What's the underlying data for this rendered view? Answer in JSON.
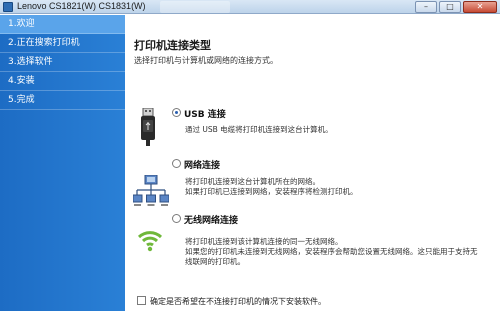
{
  "window": {
    "title": "Lenovo CS1821(W) CS1831(W)",
    "buttons": {
      "minimize": "–",
      "maximize": "□",
      "close": "✕"
    }
  },
  "sidebar": {
    "steps": [
      {
        "label": "1.欢迎"
      },
      {
        "label": "2.正在搜索打印机"
      },
      {
        "label": "3.选择软件"
      },
      {
        "label": "4.安装"
      },
      {
        "label": "5.完成"
      }
    ]
  },
  "main": {
    "heading": "打印机连接类型",
    "subheading": "选择打印机与计算机或网络的连接方式。",
    "options": [
      {
        "label": "USB 连接",
        "icon": "usb-plug-icon",
        "selected": true,
        "desc": [
          "通过 USB 电缆将打印机连接到这台计算机。"
        ]
      },
      {
        "label": "网络连接",
        "icon": "network-icon",
        "selected": false,
        "desc": [
          "将打印机连接到这台计算机所在的网络。",
          "如果打印机已连接到网络，安装程序将检测打印机。"
        ]
      },
      {
        "label": "无线网络连接",
        "icon": "wifi-icon",
        "selected": false,
        "desc": [
          "将打印机连接到该计算机连接的同一无线网络。",
          "如果您的打印机未连接到无线网络，安装程序会帮助您设置无线网络。这只能用于支持无",
          "线联网的打印机。"
        ]
      }
    ],
    "install_without_connection": {
      "label": "确定是否希望在不连接打印机的情况下安装软件。",
      "checked": false
    }
  },
  "colors": {
    "sidebar": "#1d6cc4",
    "sidebar_active": "#5aa4ea",
    "titlebar": "#c9dcef"
  }
}
